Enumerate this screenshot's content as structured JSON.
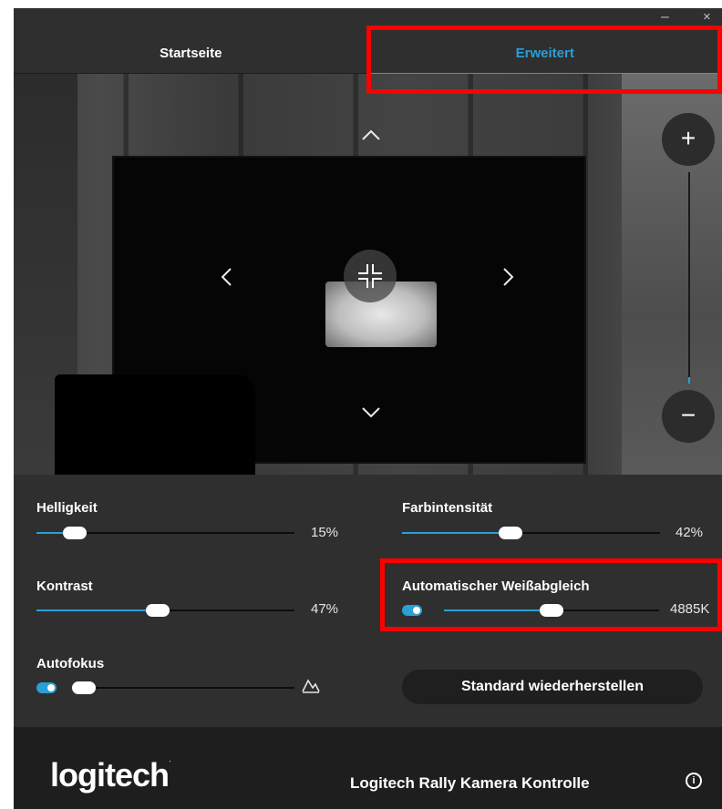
{
  "window": {
    "minimize_glyph": "–",
    "close_glyph": "×"
  },
  "tabs": [
    {
      "label": "Startseite",
      "active": false
    },
    {
      "label": "Erweitert",
      "active": true
    }
  ],
  "camera": {
    "pan_tilt": {
      "up_icon": "chevron-up-icon",
      "down_icon": "chevron-down-icon",
      "left_icon": "chevron-left-icon",
      "right_icon": "chevron-right-icon",
      "center_icon": "center-crosshair-icon"
    },
    "zoom": {
      "in_label": "+",
      "out_label": "−",
      "level": 0.03
    }
  },
  "controls": {
    "brightness": {
      "label": "Helligkeit",
      "value": "15%",
      "level": 0.15
    },
    "contrast": {
      "label": "Kontrast",
      "value": "47%",
      "level": 0.47
    },
    "autofocus": {
      "label": "Autofokus",
      "enabled": true,
      "focus_level": 0.0,
      "icon": "focus-mountain-icon"
    },
    "saturation": {
      "label": "Farbintensität",
      "value": "42%",
      "level": 0.42
    },
    "white_balance": {
      "label": "Automatischer Weißabgleich",
      "enabled": true,
      "value": "4885K",
      "level": 0.5
    },
    "reset_label": "Standard wiederherstellen"
  },
  "footer": {
    "logo_text": "logitech",
    "logo_mark": "·",
    "title": "Logitech Rally Kamera Kontrolle",
    "info_glyph": "i"
  },
  "colors": {
    "accent": "#2a9fd8",
    "highlight": "#ff0000"
  }
}
